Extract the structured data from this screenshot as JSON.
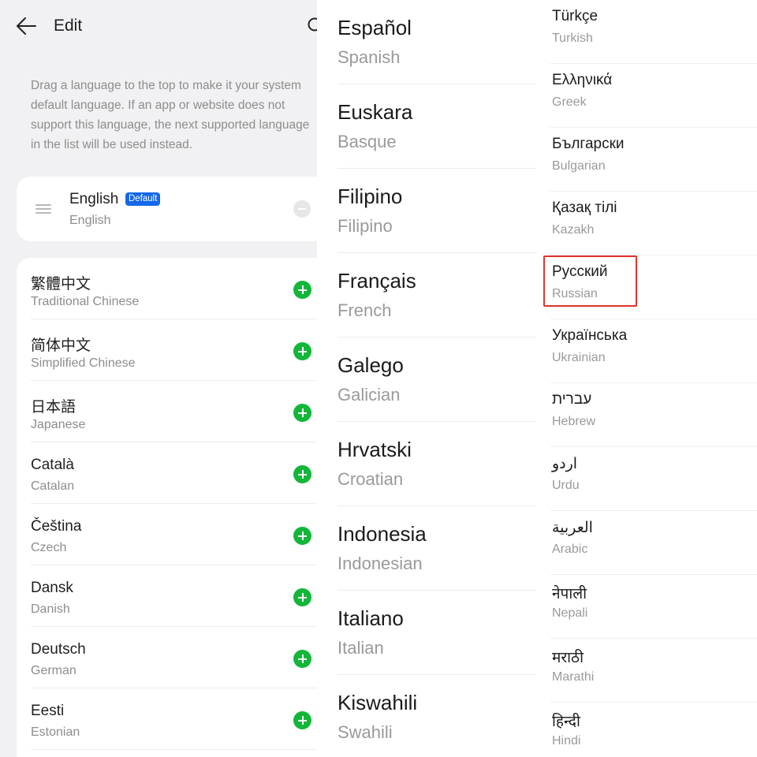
{
  "header": {
    "title": "Edit"
  },
  "hint": "Drag a language to the top to make it your system default language. If an app or website does not support this language, the next supported language in the list will be used instead.",
  "default_language": {
    "native": "English",
    "badge": "Default",
    "english": "English"
  },
  "language_list": [
    {
      "native": "繁體中文",
      "english": "Traditional Chinese"
    },
    {
      "native": "简体中文",
      "english": "Simplified Chinese"
    },
    {
      "native": "日本語",
      "english": "Japanese"
    },
    {
      "native": "Català",
      "english": "Catalan"
    },
    {
      "native": "Čeština",
      "english": "Czech"
    },
    {
      "native": "Dansk",
      "english": "Danish"
    },
    {
      "native": "Deutsch",
      "english": "German"
    },
    {
      "native": "Eesti",
      "english": "Estonian"
    }
  ],
  "middle_list": [
    {
      "native": "Español",
      "english": "Spanish"
    },
    {
      "native": "Euskara",
      "english": "Basque"
    },
    {
      "native": "Filipino",
      "english": "Filipino"
    },
    {
      "native": "Français",
      "english": "French"
    },
    {
      "native": "Galego",
      "english": "Galician"
    },
    {
      "native": "Hrvatski",
      "english": "Croatian"
    },
    {
      "native": "Indonesia",
      "english": "Indonesian"
    },
    {
      "native": "Italiano",
      "english": "Italian"
    },
    {
      "native": "Kiswahili",
      "english": "Swahili"
    }
  ],
  "right_list": [
    {
      "native": "Türkçe",
      "english": "Turkish"
    },
    {
      "native": "Ελληνικά",
      "english": "Greek"
    },
    {
      "native": "Български",
      "english": "Bulgarian"
    },
    {
      "native": "Қазақ тілі",
      "english": "Kazakh"
    },
    {
      "native": "Русский",
      "english": "Russian"
    },
    {
      "native": "Українська",
      "english": "Ukrainian"
    },
    {
      "native": "עברית",
      "english": "Hebrew"
    },
    {
      "native": "اردو",
      "english": "Urdu"
    },
    {
      "native": "العربية",
      "english": "Arabic"
    },
    {
      "native": "नेपाली",
      "english": "Nepali"
    },
    {
      "native": "मराठी",
      "english": "Marathi"
    },
    {
      "native": "हिन्दी",
      "english": "Hindi"
    }
  ],
  "icons": {
    "back": "arrow-left-icon",
    "search": "search-icon",
    "drag": "drag-handle-icon",
    "remove": "remove-circle-icon",
    "add": "add-circle-icon"
  },
  "colors": {
    "accent_green": "#12b739",
    "badge_blue": "#1368e8",
    "highlight_red": "#e0332c"
  }
}
